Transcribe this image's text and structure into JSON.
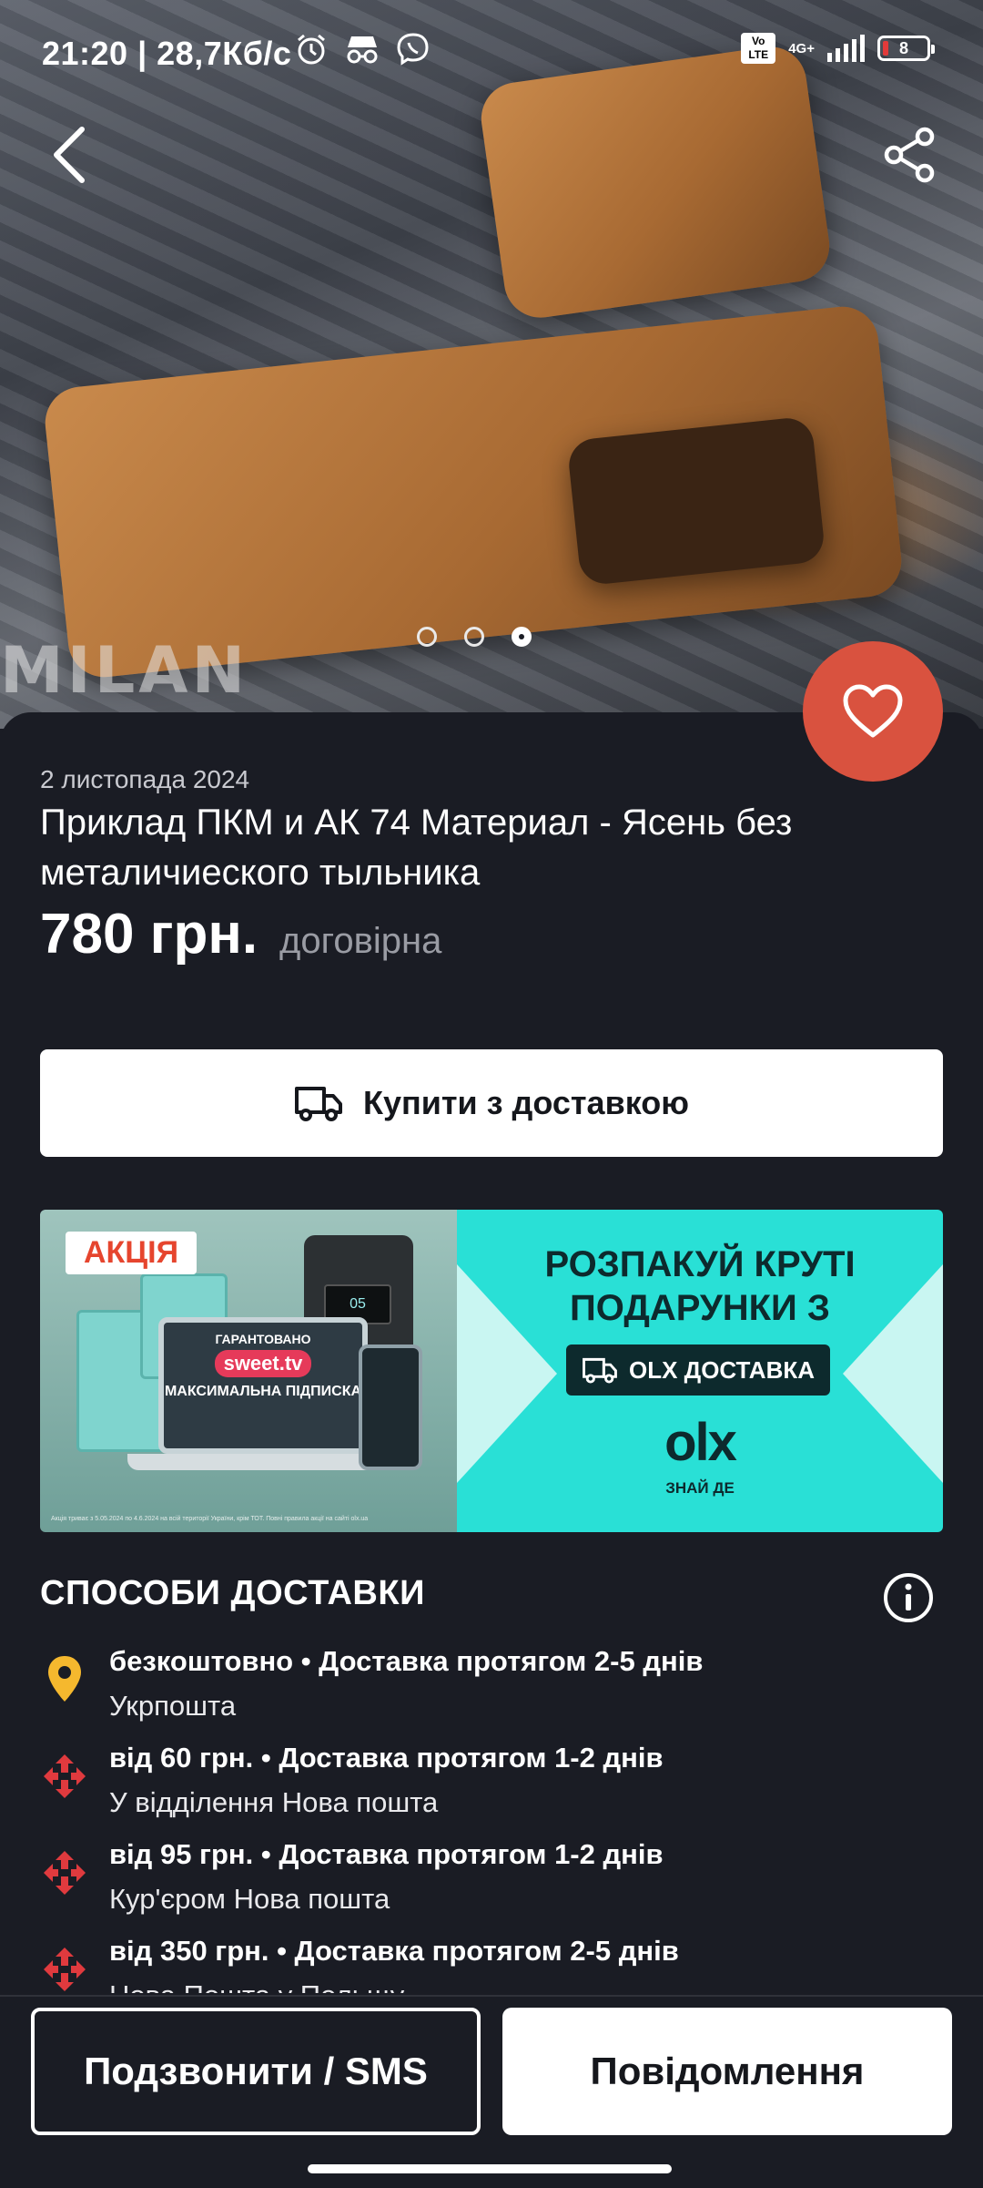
{
  "status_bar": {
    "time": "21:20 | 28,7Кб/с",
    "network": "4G+",
    "volte": "Vo LTE",
    "battery": "8"
  },
  "gallery": {
    "image_label": "MILAN",
    "dots_total": 3,
    "active_dot": 3
  },
  "listing": {
    "date": "2 листопада 2024",
    "title": "Приклад ПКМ и АК 74 Материал - Ясень без металичиеского тыльника",
    "price": "780 грн.",
    "negotiable": "договірна",
    "buy_label": "Купити з доставкою"
  },
  "banner": {
    "promo_badge": "АКЦІЯ",
    "guaranteed": "ГАРАНТОВАНО",
    "brand": "sweet.tv",
    "subscription": "МАКСИМАЛЬНА ПІДПИСКА",
    "station_display": "05",
    "headline": "РОЗПАКУЙ КРУТІ ПОДАРУНКИ З",
    "delivery_chip": "OLX ДОСТАВКА",
    "logo": "olx",
    "slogan": "ЗНАЙ ДЕ",
    "fine_print": "Акція триває з 5.05.2024 по 4.6.2024 на всій території України, крім ТОТ. Повні правила акції на сайті olx.ua"
  },
  "delivery": {
    "title": "СПОСОБИ ДОСТАВКИ",
    "items": [
      {
        "line1": "безкоштовно • Доставка протягом 2-5 днів",
        "line2": "Укрпошта",
        "icon": "ukrposhta-pin-icon"
      },
      {
        "line1": "від 60 грн. • Доставка протягом 1-2 днів",
        "line2": "У відділення Нова пошта",
        "icon": "nova-poshta-icon"
      },
      {
        "line1": "від 95 грн. • Доставка протягом 1-2 днів",
        "line2": "Кур'єром Нова пошта",
        "icon": "nova-poshta-icon"
      },
      {
        "line1": "від 350 грн. • Доставка протягом 2-5 днів",
        "line2": "Нова Пошта у Польщу",
        "icon": "nova-poshta-icon"
      }
    ]
  },
  "actions": {
    "call_label": "Подзвонити / SMS",
    "message_label": "Повідомлення"
  },
  "colors": {
    "background": "#1a1c24",
    "favorite": "#d9523f",
    "banner_teal": "#29e0d6",
    "ukrposhta_yellow": "#f5b82e",
    "nova_poshta_red": "#e03a3e"
  }
}
